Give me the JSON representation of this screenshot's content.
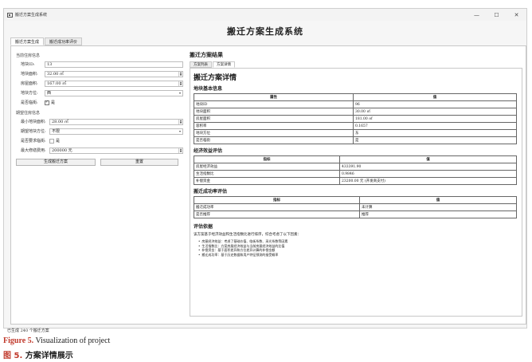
{
  "window": {
    "title": "搬迁方案生成系统",
    "controls": {
      "minimize": "—",
      "maximize": "☐",
      "close": "✕"
    }
  },
  "app_heading": "搬迁方案生成系统",
  "main_tabs": [
    {
      "label": "搬迁方案生成"
    },
    {
      "label": "搬迁成功率评价"
    }
  ],
  "current_plot": {
    "group_title": "当前住房信息",
    "plot_id_label": "地块ID:",
    "plot_id_value": "13",
    "plot_area_label": "地块面积:",
    "plot_area_value": "32.00 ㎡",
    "building_area_label": "房屋面积:",
    "building_area_value": "167.00 ㎡",
    "orientation_label": "地块方位:",
    "orientation_value": "西",
    "road_label": "是否临街:",
    "road_checked": "✓",
    "road_text": "是"
  },
  "expected": {
    "group_title": "期望住房信息",
    "min_area_label": "最小地块面积:",
    "min_area_value": "28.00 ㎡",
    "exp_orientation_label": "期望地块方位:",
    "exp_orientation_value": "不限",
    "require_road_label": "是否要求临街:",
    "require_road_text": "是",
    "max_cost_label": "最大修缮费用:",
    "max_cost_value": "200000 元"
  },
  "buttons": {
    "generate": "生成搬迁方案",
    "reset": "重置"
  },
  "result": {
    "title": "搬迁方案结果",
    "subtabs": [
      {
        "label": "方案列表"
      },
      {
        "label": "方案详情"
      }
    ],
    "detail_heading": "搬迁方案详情",
    "basic_title": "地块基本信息",
    "basic_headers": [
      "属性",
      "值"
    ],
    "basic_rows": [
      [
        "地块ID",
        "96"
      ],
      [
        "地块面积",
        "30.00 ㎡"
      ],
      [
        "房屋面积",
        "181.00 ㎡"
      ],
      [
        "容积率",
        "0.1657"
      ],
      [
        "地块方位",
        "东"
      ],
      [
        "是否临街",
        "是"
      ]
    ],
    "econ_title": "经济效益评估",
    "econ_headers": [
      "指标",
      "值"
    ],
    "econ_rows": [
      [
        "房屋经济效益",
        "433391.90"
      ],
      [
        "生活指数比",
        "0.9846"
      ],
      [
        "补偿资金",
        "23200.00 元 (开发商支付)"
      ]
    ],
    "success_title": "搬迁成功率评估",
    "success_headers": [
      "指标",
      "值"
    ],
    "success_rows": [
      [
        "搬迁成功率",
        "未计算"
      ],
      [
        "是否推荐",
        "推荐"
      ]
    ],
    "basis_title": "评估依据",
    "basis_intro": "该方案基于经济效益和生活指数比进行排序，综合考虑了以下因素：",
    "basis_items": [
      "房屋经济效益：考虑了基础价值、临街系数、采光系数等因素",
      "生活指数比：方案房屋经济效益与当前房屋经济效益的比值",
      "补偿资金：基于面积差异和方位差异计算的补偿金额",
      "搬迁成功率：基于历史数据和用户特征预测的接受概率"
    ]
  },
  "status_bar": "已生成 240 个搬迁方案",
  "caption": {
    "en_label": "Figure 5.",
    "en_text": " Visualization of project",
    "zh_label": "图 5.",
    "zh_text": " 方案详情展示"
  }
}
